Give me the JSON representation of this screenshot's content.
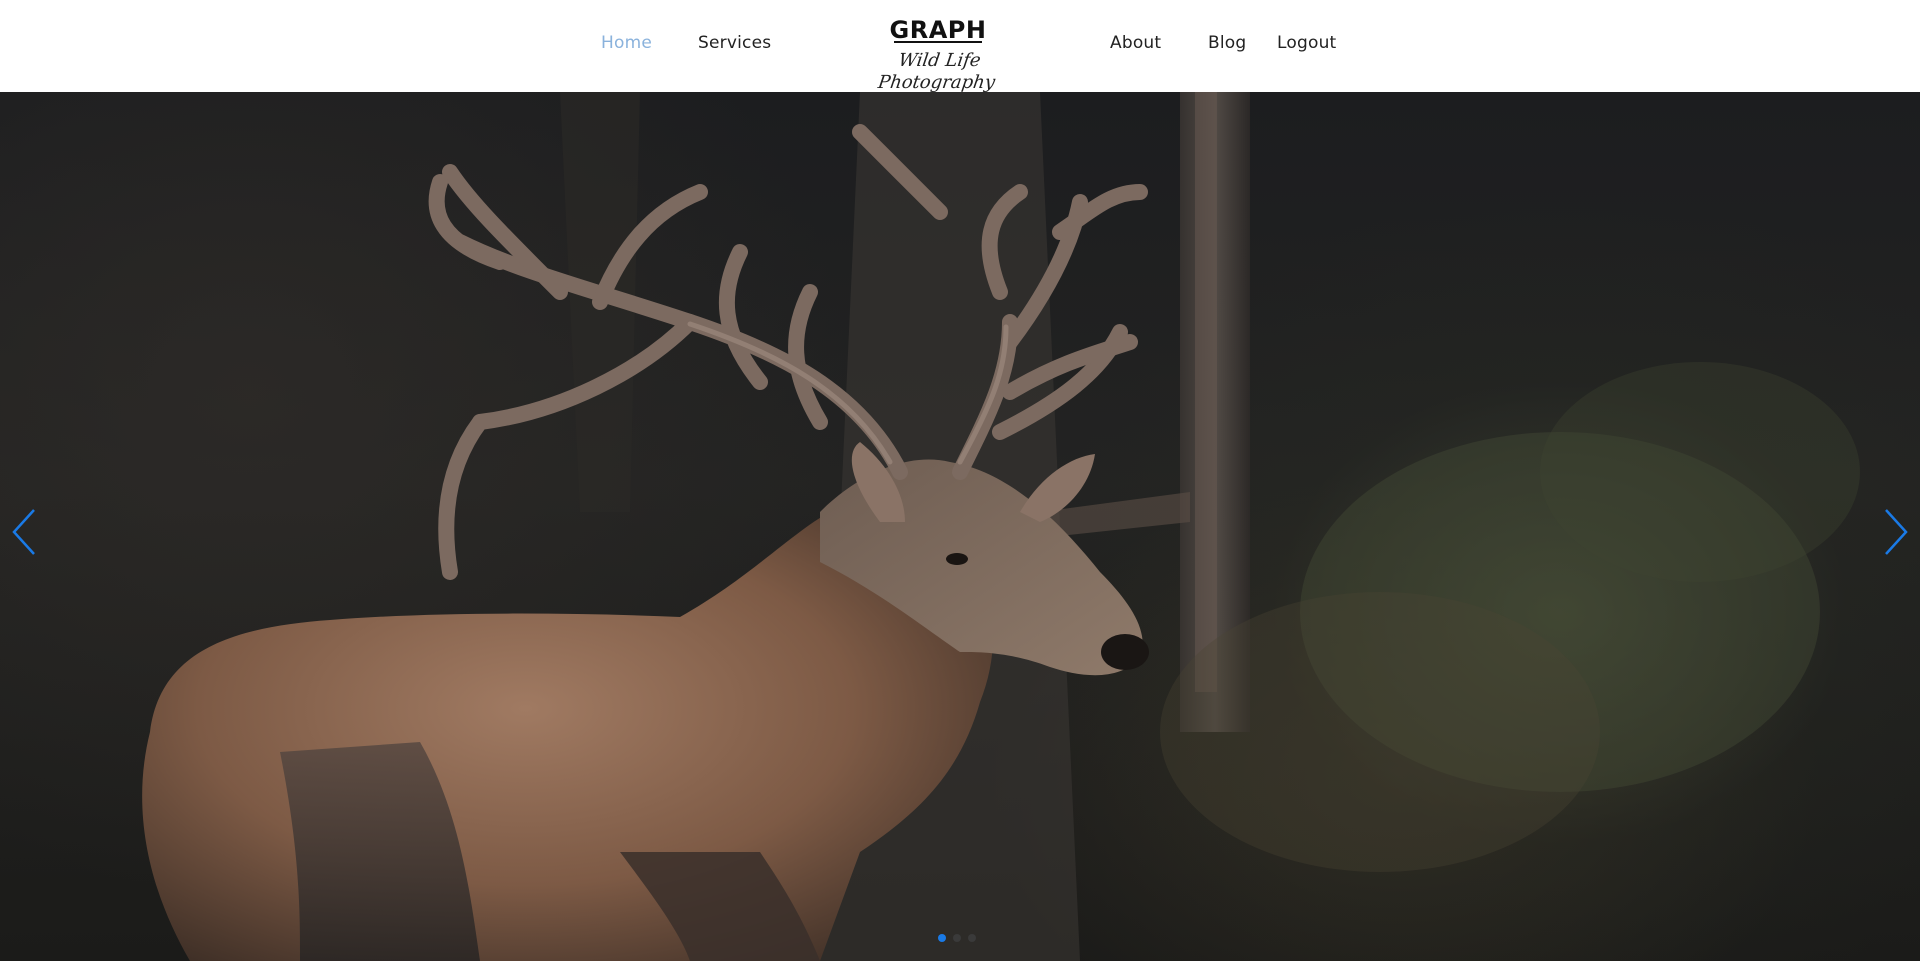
{
  "nav": {
    "home": "Home",
    "services": "Services",
    "about": "About",
    "blog": "Blog",
    "logout": "Logout",
    "active_item": "Home"
  },
  "logo": {
    "title": "GRAPH",
    "subtitle": "Wild Life Photography"
  },
  "slider": {
    "image": "deer-with-antlers-in-forest",
    "prev_icon": "chevron-left-icon",
    "next_icon": "chevron-right-icon",
    "slide_count": 3,
    "active_slide": 1
  },
  "colors": {
    "nav_active": "#8ab2dc",
    "nav_text": "#222222",
    "accent": "#1a7ae6",
    "header_bg": "#ffffff"
  }
}
